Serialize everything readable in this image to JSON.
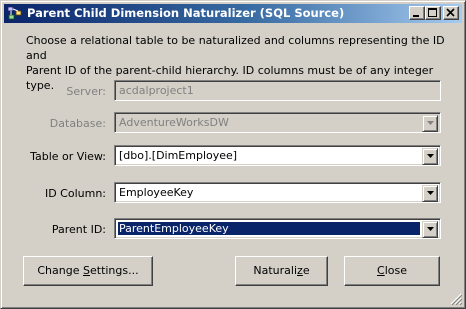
{
  "window": {
    "title": "Parent Child Dimension Naturalizer (SQL Source)",
    "icon": "app-icon",
    "title_bar_colors": [
      "#0a246a",
      "#a6caf0"
    ]
  },
  "description": "Choose a relational table to be naturalized and columns representing the ID and\nParent ID of the parent-child hierarchy.  ID columns must be of any integer type.",
  "fields": {
    "server": {
      "label": "Server:",
      "value": "acdalproject1",
      "enabled": false
    },
    "database": {
      "label": "Database:",
      "value": "AdventureWorksDW",
      "enabled": false
    },
    "table": {
      "label": "Table or View:",
      "value": "[dbo].[DimEmployee]",
      "enabled": true
    },
    "id_column": {
      "label": "ID Column:",
      "value": "EmployeeKey",
      "enabled": true
    },
    "parent_id": {
      "label": "Parent ID:",
      "value": "ParentEmployeeKey",
      "enabled": true,
      "focused": true
    }
  },
  "buttons": {
    "change_settings_pre": "Change ",
    "change_settings_mn": "S",
    "change_settings_post": "ettings...",
    "naturalize_pre": "Naturali",
    "naturalize_mn": "z",
    "naturalize_post": "e",
    "close_mn": "C",
    "close_post": "lose"
  },
  "colors": {
    "face": "#d4d0c8",
    "selection": "#0a246a",
    "disabled_text": "#808080"
  }
}
